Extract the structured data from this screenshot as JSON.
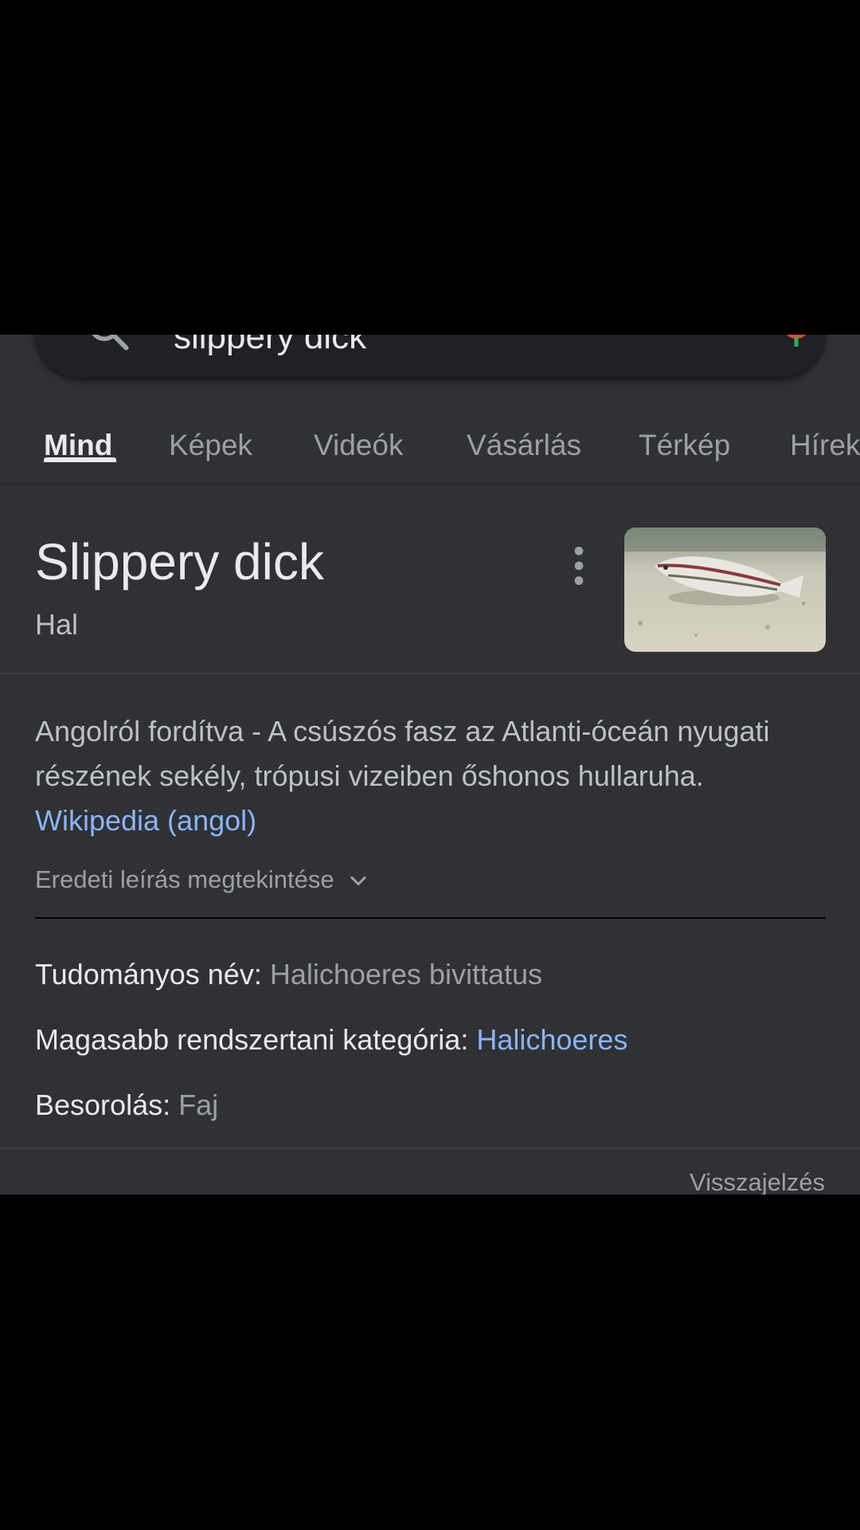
{
  "search": {
    "query": "slippery dick"
  },
  "tabs": [
    {
      "label": "Mind",
      "active": true
    },
    {
      "label": "Képek",
      "active": false
    },
    {
      "label": "Videók",
      "active": false
    },
    {
      "label": "Vásárlás",
      "active": false
    },
    {
      "label": "Térkép",
      "active": false
    },
    {
      "label": "Hírek",
      "active": false
    }
  ],
  "panel": {
    "title": "Slippery dick",
    "subtitle": "Hal",
    "description_text": "Angolról fordítva - A csúszós fasz az Atlanti-óceán nyugati részének sekély, trópusi vizeiben őshonos hullaruha.",
    "source_link": "Wikipedia (angol)",
    "original_toggle": "Eredeti leírás megtekintése",
    "facts": [
      {
        "label": "Tudományos név:",
        "value": "Halichoeres bivittatus",
        "is_link": false
      },
      {
        "label": "Magasabb rendszertani kategória:",
        "value": "Halichoeres",
        "is_link": true
      },
      {
        "label": "Besorolás:",
        "value": "Faj",
        "is_link": false
      }
    ],
    "feedback": "Visszajelzés"
  },
  "colors": {
    "background": "#303134",
    "text_primary": "#e8eaed",
    "text_secondary": "#9aa0a6",
    "link": "#8ab4f8"
  }
}
